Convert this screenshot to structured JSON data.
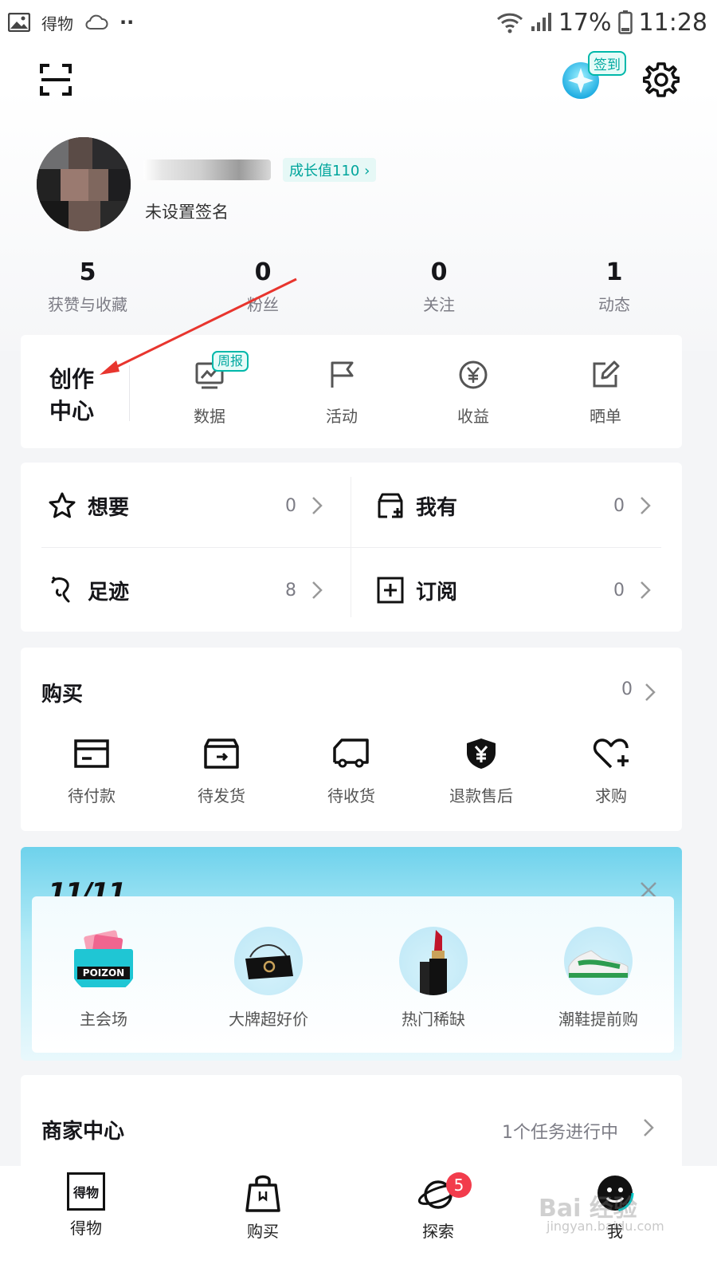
{
  "status_bar": {
    "app_name": "得物",
    "dots": "··",
    "battery": "17%",
    "time": "11:28"
  },
  "header": {
    "sign_in_badge": "签到"
  },
  "profile": {
    "growth": "成长值110 ›",
    "signature": "未设置签名"
  },
  "stats": [
    {
      "value": "5",
      "label": "获赞与收藏"
    },
    {
      "value": "0",
      "label": "粉丝"
    },
    {
      "value": "0",
      "label": "关注"
    },
    {
      "value": "1",
      "label": "动态"
    }
  ],
  "creation_center": {
    "title": "创作中心",
    "weekly_badge": "周报",
    "items": [
      {
        "label": "数据",
        "icon": "chart-screen-icon"
      },
      {
        "label": "活动",
        "icon": "flag-icon"
      },
      {
        "label": "收益",
        "icon": "yen-circle-icon"
      },
      {
        "label": "晒单",
        "icon": "edit-icon"
      }
    ]
  },
  "collections": [
    {
      "label": "想要",
      "count": "0",
      "icon": "star-icon"
    },
    {
      "label": "我有",
      "count": "0",
      "icon": "box-add-icon"
    },
    {
      "label": "足迹",
      "count": "8",
      "icon": "footprint-icon"
    },
    {
      "label": "订阅",
      "count": "0",
      "icon": "plus-square-icon"
    }
  ],
  "purchase": {
    "title": "购买",
    "count": "0",
    "items": [
      {
        "label": "待付款",
        "icon": "card-icon"
      },
      {
        "label": "待发货",
        "icon": "box-icon"
      },
      {
        "label": "待收货",
        "icon": "truck-icon"
      },
      {
        "label": "退款售后",
        "icon": "shield-yen-icon"
      },
      {
        "label": "求购",
        "icon": "heart-plus-icon"
      }
    ]
  },
  "promo": {
    "logo": "11/11",
    "items": [
      {
        "label": "主会场",
        "image": "poizon-card-image",
        "brand": "POIZON"
      },
      {
        "label": "大牌超好价",
        "image": "handbag-image"
      },
      {
        "label": "热门稀缺",
        "image": "lipstick-image"
      },
      {
        "label": "潮鞋提前购",
        "image": "sneaker-image"
      }
    ]
  },
  "merchant": {
    "title": "商家中心",
    "status": "1个任务进行中"
  },
  "tabbar": [
    {
      "label": "得物",
      "icon_text": "得物"
    },
    {
      "label": "购买"
    },
    {
      "label": "探索",
      "badge": "5"
    },
    {
      "label": "我"
    }
  ],
  "watermark": {
    "text": "Bai 经验",
    "url": "jingyan.baidu.com"
  },
  "colors": {
    "accent": "#00b8aa",
    "badge_red": "#f23c4c",
    "annotation_arrow": "#e8352e"
  }
}
